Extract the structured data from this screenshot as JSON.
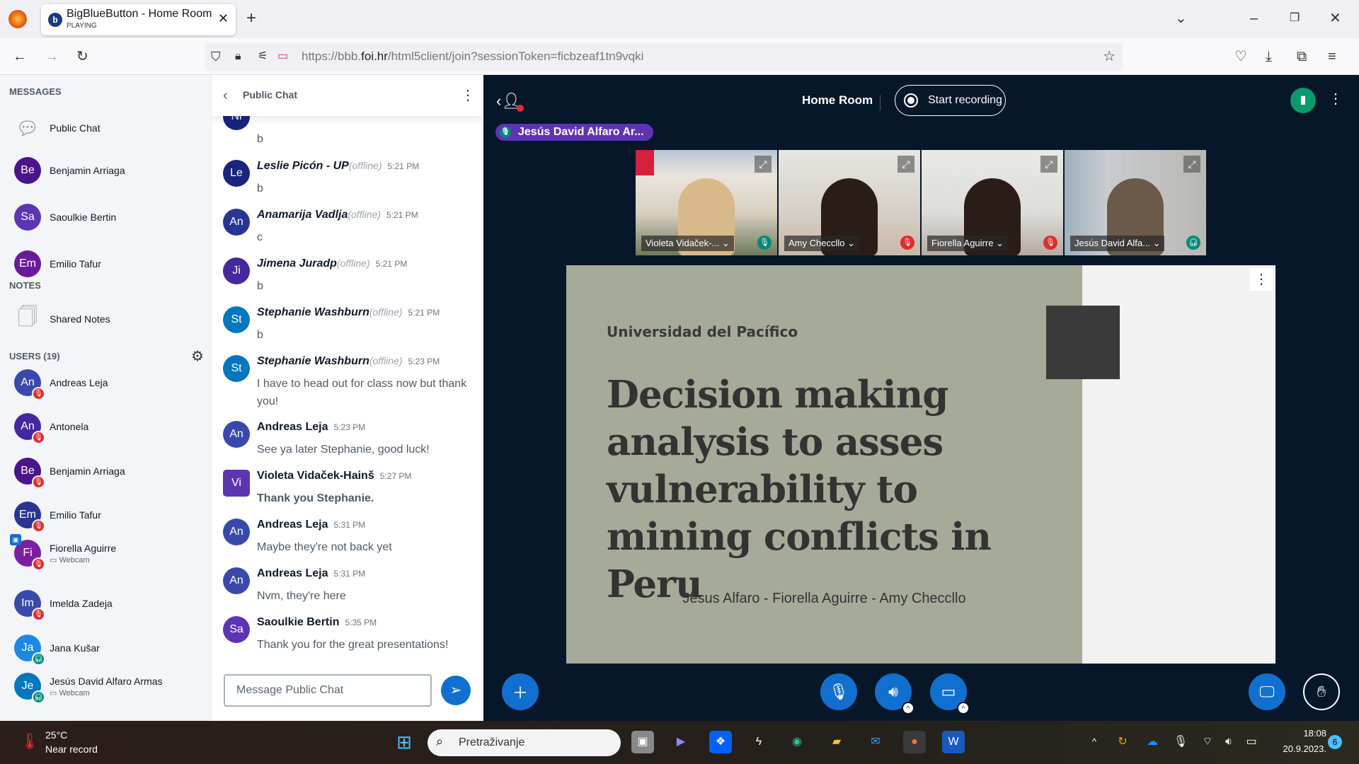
{
  "browser": {
    "tab_title": "BigBlueButton - Home Room",
    "tab_status": "PLAYING",
    "url_prefix": "https://bbb.",
    "url_domain": "foi.hr",
    "url_rest": "/html5client/join?sessionToken=ficbzeaf1tn9vqki"
  },
  "sidebar": {
    "messages_heading": "MESSAGES",
    "messages": [
      {
        "label": "Public Chat",
        "icon": "chat-bubbles-icon"
      },
      {
        "label": "Benjamin Arriaga",
        "initials": "Be",
        "color": "#4a148c"
      },
      {
        "label": "Saoulkie Bertin",
        "initials": "Sa",
        "color": "#5e35b1"
      },
      {
        "label": "Emilio Tafur",
        "initials": "Em",
        "color": "#6a1b9a"
      }
    ],
    "notes_heading": "NOTES",
    "shared_notes": "Shared Notes",
    "users_heading": "USERS (19)",
    "users": [
      {
        "name": "Andreas Leja",
        "initials": "An",
        "color": "#3949ab",
        "status": "muted"
      },
      {
        "name": "Antonela",
        "initials": "An",
        "color": "#4527a0",
        "status": "muted"
      },
      {
        "name": "Benjamin Arriaga",
        "initials": "Be",
        "color": "#4a148c",
        "status": "muted"
      },
      {
        "name": "Emilio Tafur",
        "initials": "Em",
        "color": "#283593",
        "status": "muted"
      },
      {
        "name": "Fiorella Aguirre",
        "initials": "Fi",
        "color": "#7b1fa2",
        "status": "muted",
        "sub": "Webcam",
        "presenter": true
      },
      {
        "name": "Imelda Zadeja",
        "initials": "Im",
        "color": "#3949ab",
        "status": "muted"
      },
      {
        "name": "Jana Kušar",
        "initials": "Ja",
        "color": "#1e88e5",
        "status": "listen"
      },
      {
        "name": "Jesús David Alfaro Armas",
        "initials": "Je",
        "color": "#0277bd",
        "status": "listen",
        "sub": "Webcam"
      }
    ]
  },
  "chat": {
    "title": "Public Chat",
    "offline": "(offline)",
    "messages": [
      {
        "initials": "Le",
        "color": "#1a237e",
        "name": "Leslie Picón - UP",
        "offline": true,
        "time": "5:21 PM",
        "text": "b"
      },
      {
        "initials": "An",
        "color": "#283593",
        "name": "Anamarija Vadlja",
        "offline": true,
        "time": "5:21 PM",
        "text": "c"
      },
      {
        "initials": "Ji",
        "color": "#4527a0",
        "name": "Jimena Juradp",
        "offline": true,
        "time": "5:21 PM",
        "text": "b"
      },
      {
        "initials": "St",
        "color": "#0277bd",
        "name": "Stephanie Washburn",
        "offline": true,
        "time": "5:21 PM",
        "text": "b"
      },
      {
        "initials": "St",
        "color": "#0277bd",
        "name": "Stephanie Washburn",
        "offline": true,
        "time": "5:23 PM",
        "text": "I have to head out for class now but thank you!"
      },
      {
        "initials": "An",
        "color": "#3949ab",
        "name": "Andreas Leja",
        "time": "5:23 PM",
        "text": "See ya later Stephanie, good luck!"
      },
      {
        "initials": "Vi",
        "color": "#5e35b1",
        "name": "Violeta Vidaček-Hainš",
        "time": "5:27 PM",
        "text": "Thank you Stephanie.",
        "moderator": true
      },
      {
        "initials": "An",
        "color": "#3949ab",
        "name": "Andreas Leja",
        "time": "5:31 PM",
        "text": "Maybe they're not back yet"
      },
      {
        "initials": "An",
        "color": "#3949ab",
        "name": "Andreas Leja",
        "time": "5:31 PM",
        "text": "Nvm, they're here"
      },
      {
        "initials": "Sa",
        "color": "#5e35b1",
        "name": "Saoulkie Bertin",
        "time": "5:35 PM",
        "text": "Thank you for the great presentations!"
      }
    ],
    "partial_top_initials": "Ni",
    "partial_top_text": "b",
    "input_placeholder": "Message Public Chat"
  },
  "meeting": {
    "room_name": "Home Room",
    "record_label": "Start recording",
    "talking": "Jesús David Alfaro Ar...",
    "videos": [
      {
        "name": "Violeta Vidaček-...",
        "status": "mic-on",
        "logo": "foi"
      },
      {
        "name": "Amy Checcllo",
        "status": "muted"
      },
      {
        "name": "Fiorella Aguirre",
        "status": "muted"
      },
      {
        "name": "Jesús David Alfa...",
        "status": "listen"
      }
    ],
    "slide": {
      "institution": "Universidad del Pacífico",
      "title": "Decision making analysis to asses vulnerability to mining conflicts in Peru",
      "authors": "Jesus Alfaro - Fiorella Aguirre - Amy Checcllo"
    }
  },
  "taskbar": {
    "temp": "25°C",
    "weather": "Near record",
    "search_placeholder": "Pretraživanje",
    "time": "18:08",
    "date": "20.9.2023.",
    "notifications": "6"
  },
  "colors": {
    "accent": "#1170cf",
    "main_bg": "#06172a",
    "muted": "#e02d2d",
    "listen": "#00897b",
    "talking": "#5e35b1",
    "slide_bg": "#a6aa98"
  }
}
